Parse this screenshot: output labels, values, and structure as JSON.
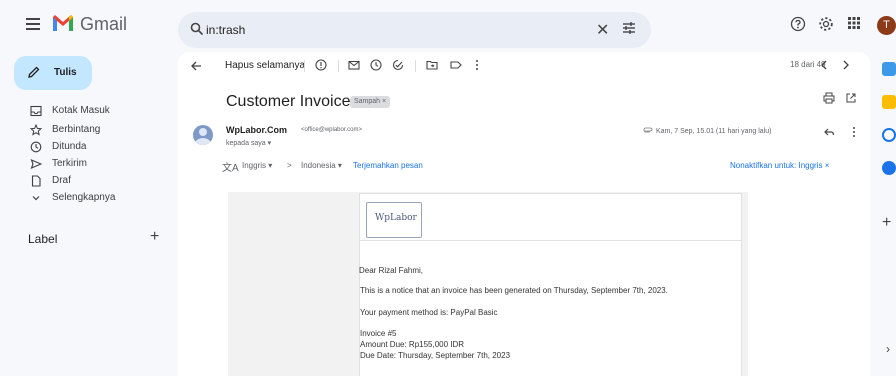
{
  "app": {
    "name": "Gmail",
    "avatar_initial": "T"
  },
  "search": {
    "value": "in:trash"
  },
  "sidebar": {
    "compose_label": "Tulis",
    "items": [
      {
        "label": "Kotak Masuk",
        "icon": "inbox-icon"
      },
      {
        "label": "Berbintang",
        "icon": "star-icon"
      },
      {
        "label": "Ditunda",
        "icon": "clock-icon"
      },
      {
        "label": "Terkirim",
        "icon": "send-icon"
      },
      {
        "label": "Draf",
        "icon": "draft-icon"
      },
      {
        "label": "Selengkapnya",
        "icon": "chevron-down-icon"
      }
    ],
    "labels_heading": "Label"
  },
  "toolbar": {
    "delete_forever": "Hapus selamanya",
    "pager": "18 dari 49"
  },
  "email": {
    "subject": "Customer Invoice",
    "badge": "Sampah ×",
    "sender_name": "WpLabor.Com",
    "sender_email": "<office@wplabor.com>",
    "to_me": "kepada saya ▾",
    "date": "Kam, 7 Sep, 15.01 (11 hari yang lalu)",
    "translate": {
      "from": "Inggris ▾",
      "arrow": ">",
      "to": "Indonesia ▾",
      "action": "Terjemahkan pesan",
      "disable": "Nonaktifkan untuk: Inggris ×"
    },
    "logo_text": "WpLabor",
    "body": {
      "greeting": "Dear Rizal Fahmi,",
      "line1": "This is a notice that an invoice has been generated on Thursday, September 7th, 2023.",
      "line2": "Your payment method is: PayPal Basic",
      "invoice_no": "Invoice #5",
      "amount": "Amount Due: Rp155,000 IDR",
      "due": "Due Date: Thursday, September 7th, 2023"
    }
  },
  "colors": {
    "compose_bg": "#c2e7ff",
    "search_bg": "#e9eef6",
    "link": "#1a73e8",
    "avatar_bg": "#8c3a18"
  }
}
